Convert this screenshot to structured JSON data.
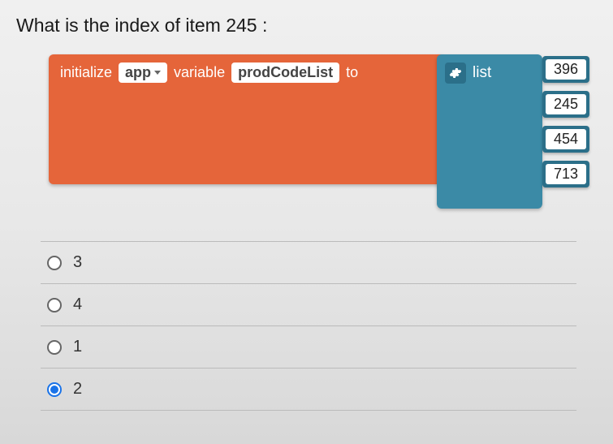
{
  "question": "What is the index of item 245 :",
  "block": {
    "initialize": "initialize",
    "scope": "app",
    "variable_kw": "variable",
    "variable_name": "prodCodeList",
    "to": "to",
    "list_label": "list",
    "items": [
      "396",
      "245",
      "454",
      "713"
    ]
  },
  "options": [
    {
      "label": "3",
      "selected": false
    },
    {
      "label": "4",
      "selected": false
    },
    {
      "label": "1",
      "selected": false
    },
    {
      "label": "2",
      "selected": true
    }
  ]
}
